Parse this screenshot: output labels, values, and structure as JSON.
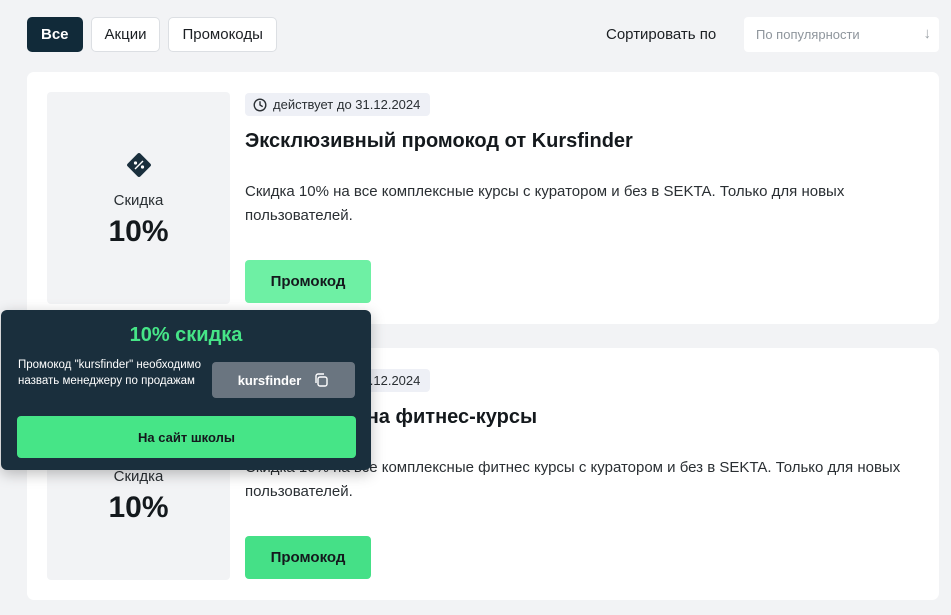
{
  "filters": {
    "all": "Все",
    "sales": "Акции",
    "promocodes": "Промокоды"
  },
  "sort": {
    "label": "Сортировать по",
    "placeholder": "По популярности"
  },
  "cards": [
    {
      "badge": "действует до 31.12.2024",
      "title": "Эксклюзивный промокод от Kursfinder",
      "description": "Скидка 10% на все комплексные курсы с куратором и без в SEKTA. Только для новых пользователей.",
      "discount_label": "Скидка",
      "discount_value": "10%",
      "button": "Промокод"
    },
    {
      "badge": "действует до 31.12.2024",
      "title": "Скидка 10% на фитнес-курсы",
      "description": "Скидка 10% на все комплексные фитнес курсы с куратором и без в SEKTA. Только для новых пользователей.",
      "discount_label": "Скидка",
      "discount_value": "10%",
      "button": "Промокод"
    }
  ],
  "popup": {
    "title": "10% скидка",
    "text": "Промокод \"kursfinder\" необходимо назвать менеджеру по продажам",
    "code": "kursfinder",
    "cta": "На сайт школы"
  },
  "colors": {
    "accent": "#46e587",
    "dark": "#112a39"
  }
}
